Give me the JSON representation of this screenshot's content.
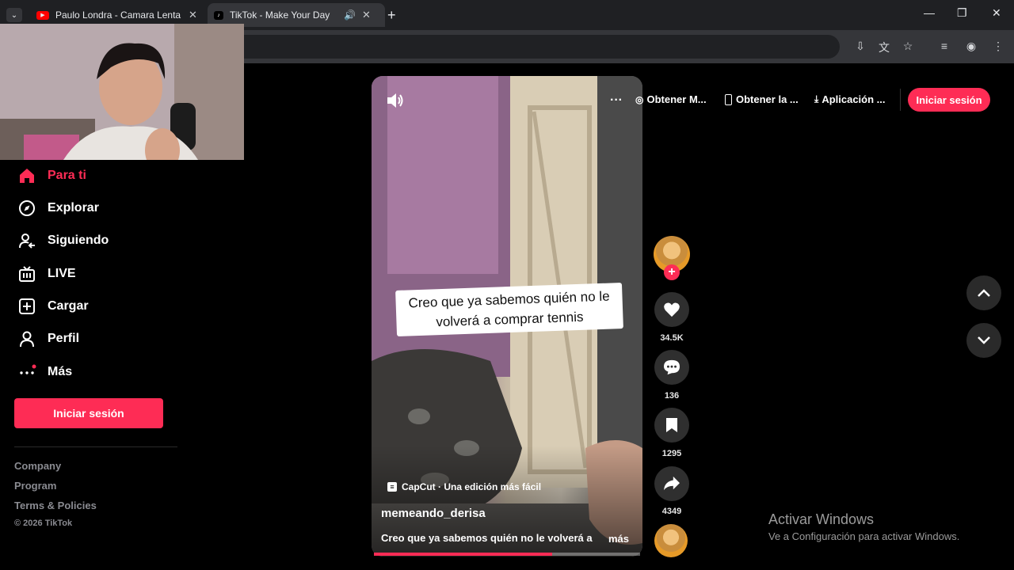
{
  "browser": {
    "tabs": [
      {
        "title": "Paulo Londra - Camara Lenta (C",
        "favicon": "youtube-icon",
        "active": false
      },
      {
        "title": "TikTok - Make Your Day",
        "favicon": "tiktok-icon",
        "active": true
      }
    ],
    "new_tab": "+",
    "window": {
      "minimize": "—",
      "restore": "❐",
      "close": "✕"
    }
  },
  "sidebar": {
    "items": [
      {
        "label": "Para ti",
        "icon": "home-icon",
        "active": true
      },
      {
        "label": "Explorar",
        "icon": "compass-icon"
      },
      {
        "label": "Siguiendo",
        "icon": "following-icon"
      },
      {
        "label": "LIVE",
        "icon": "live-icon"
      },
      {
        "label": "Cargar",
        "icon": "upload-icon"
      },
      {
        "label": "Perfil",
        "icon": "profile-icon"
      },
      {
        "label": "Más",
        "icon": "more-icon"
      }
    ],
    "login_label": "Iniciar sesión",
    "footer": {
      "company": "Company",
      "program": "Program",
      "terms": "Terms & Policies",
      "copyright": "© 2026 TikTok"
    }
  },
  "header": {
    "links": [
      "Obtener M...",
      "Obtener la ...",
      "Aplicación ..."
    ],
    "more": "···",
    "login_label": "Iniciar sesión"
  },
  "video": {
    "caption_overlay": "Creo que ya sabemos quién no le volverá a comprar tennis",
    "capcut_label": "CapCut · Una edición más fácil",
    "username": "memeando_derisa",
    "description": "Creo que ya sabemos quién no le volverá a",
    "more_label": "más",
    "progress": 0.67
  },
  "actions": {
    "likes": "34.5K",
    "comments": "136",
    "saves": "1295",
    "shares": "4349"
  },
  "watermark": {
    "title": "Activar Windows",
    "subtitle": "Ve a Configuración para activar Windows."
  },
  "colors": {
    "accent": "#fe2c55",
    "background": "#000000"
  }
}
